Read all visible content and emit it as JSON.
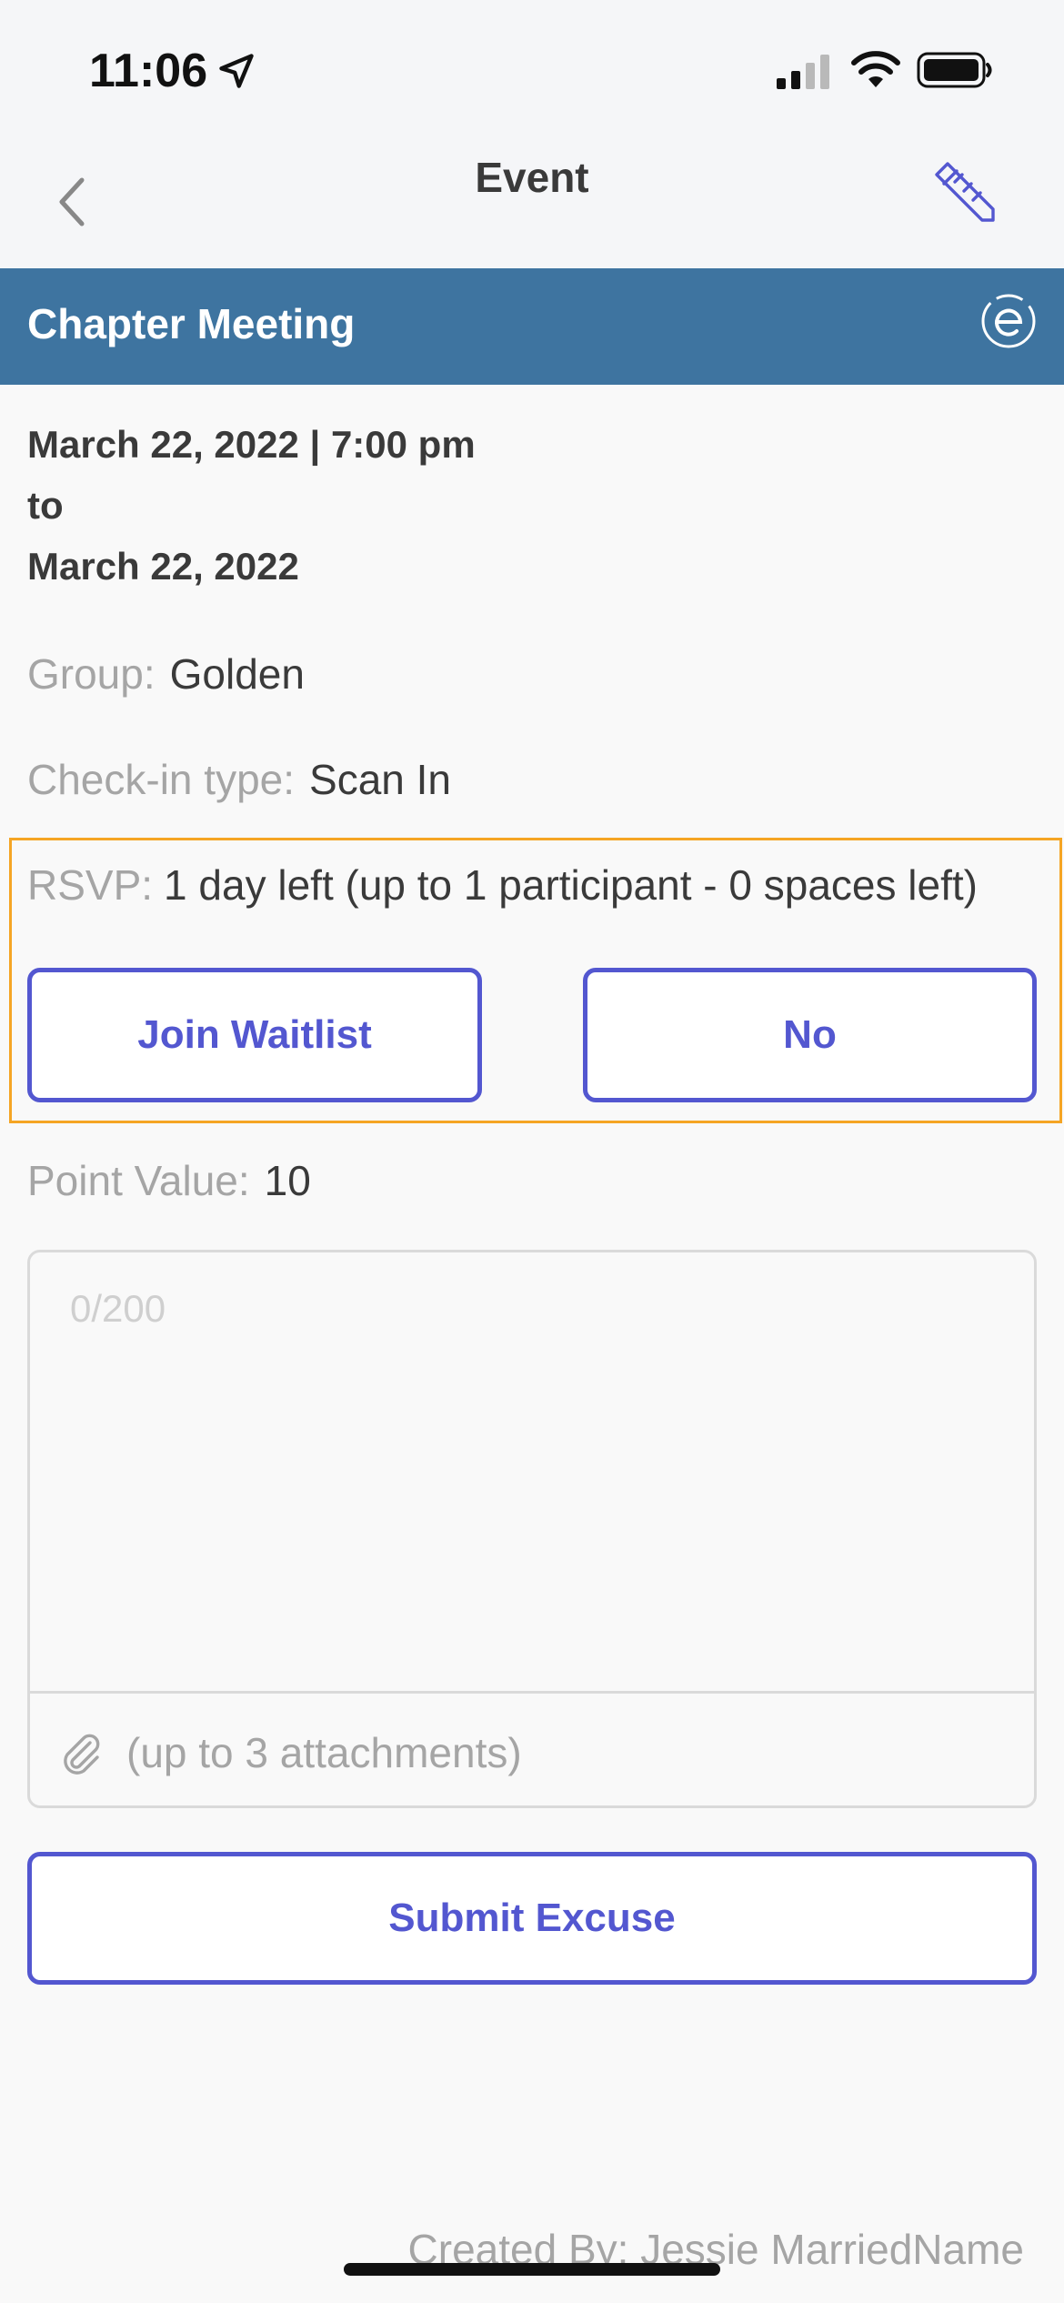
{
  "status_bar": {
    "time": "11:06"
  },
  "nav": {
    "title": "Event"
  },
  "event": {
    "title": "Chapter Meeting",
    "start": "March 22, 2022 | 7:00 pm",
    "to": "to",
    "end": "March 22, 2022",
    "group_label": "Group:",
    "group": "Golden",
    "checkin_label": "Check-in type:",
    "checkin": "Scan In",
    "rsvp_label": "RSVP:",
    "rsvp": "1 day left (up to 1 participant - 0 spaces left)",
    "join_label": "Join Waitlist",
    "no_label": "No",
    "points_label": "Point Value:",
    "points": "10"
  },
  "excuse": {
    "placeholder": "0/200",
    "attachments_hint": "(up to 3 attachments)",
    "submit_label": "Submit Excuse"
  },
  "footer": {
    "created_by": "Created By: Jessie MarriedName"
  },
  "colors": {
    "accent": "#5357d0",
    "banner": "#3e74a0",
    "highlight": "#f5a524"
  },
  "icons": [
    "location-arrow-icon",
    "cellular-signal-icon",
    "wifi-icon",
    "battery-icon",
    "back-chevron-icon",
    "pencil-icon",
    "brand-logo-icon",
    "paperclip-icon"
  ]
}
